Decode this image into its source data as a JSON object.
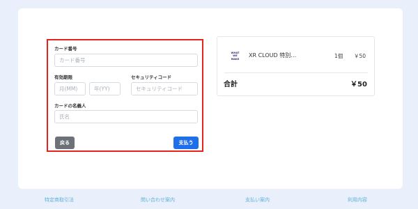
{
  "form": {
    "card_number_label": "カード番号",
    "card_number_placeholder": "カード番号",
    "expiry_label": "有効期限",
    "month_placeholder": "月(MM)",
    "year_placeholder": "年(YY)",
    "security_label": "セキュリティコード",
    "security_placeholder": "セキュリティコード",
    "name_label": "カードの名義人",
    "name_placeholder": "氏名",
    "back_button": "戻る",
    "pay_button": "支払う"
  },
  "summary": {
    "thumb_lines": [
      "WHAT",
      "WE",
      "MAKE"
    ],
    "item_name": "XR CLOUD 特別…",
    "item_qty": "1個",
    "item_price": "￥50",
    "total_label": "合計",
    "total_value": "￥50"
  },
  "footer": {
    "links": [
      "特定商取引法",
      "問い合わせ案内",
      "支払い案内",
      "利用内容"
    ]
  },
  "colors": {
    "highlight_border": "#e8211b",
    "pay_button": "#1f6feb",
    "back_button": "#6d7279",
    "footer_link": "#5fb0d8",
    "page_background": "#e9effb"
  }
}
